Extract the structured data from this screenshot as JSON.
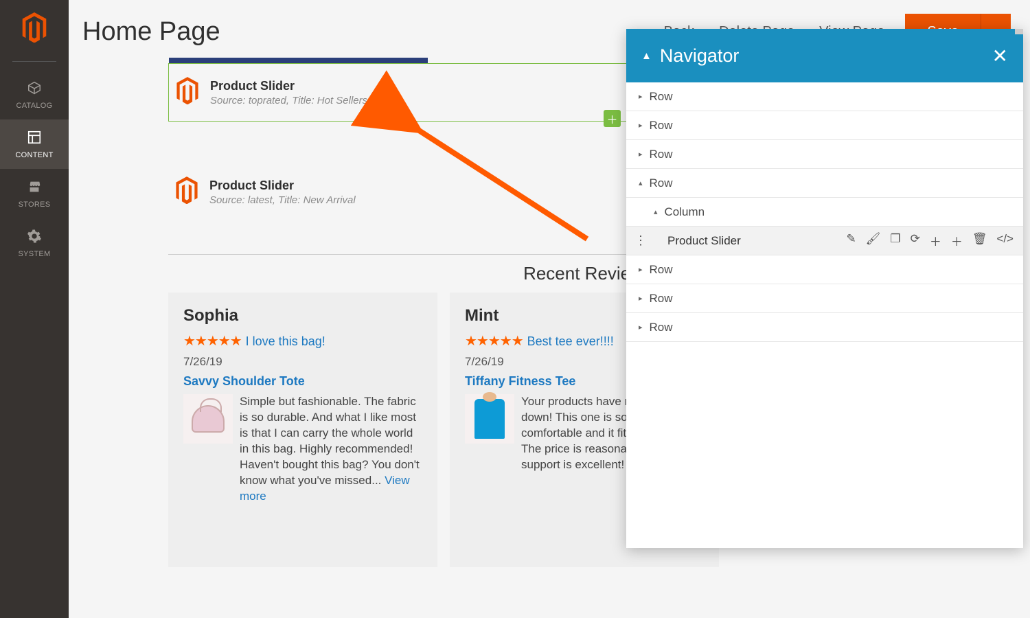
{
  "sidebar": {
    "items": [
      {
        "label": "CATALOG"
      },
      {
        "label": "CONTENT"
      },
      {
        "label": "STORES"
      },
      {
        "label": "SYSTEM"
      }
    ]
  },
  "header": {
    "title": "Home Page",
    "back": "Back",
    "delete": "Delete Page",
    "view": "View Page",
    "save": "Save"
  },
  "sliders": {
    "a": {
      "title": "Product Slider",
      "sub": "Source: toprated, Title: Hot Sellers"
    },
    "b": {
      "title": "Product Slider",
      "sub": "Source: latest, Title: New Arrival"
    }
  },
  "reviews_heading": "Recent Reviews",
  "reviews": [
    {
      "name": "Sophia",
      "title": "I love this bag!",
      "date": "7/26/19",
      "product": "Savvy Shoulder Tote",
      "body": "Simple but fashionable. The fabric is so durable. And what I like most is that I can carry the whole world in this bag. Highly recommended! Haven't bought this bag? You don't know what you've missed... ",
      "more": "View more"
    },
    {
      "name": "Mint",
      "title": "Best tee ever!!!!",
      "date": "7/26/19",
      "product": "Tiffany Fitness Tee",
      "body": "Your products have never let me down! This one is so soft and comfortable and it fits perfectly. The price is reasonable, and the support is excellent!",
      "more": ""
    }
  ],
  "navigator": {
    "title": "Navigator",
    "rows": [
      {
        "label": "Row",
        "caret": "right",
        "indent": 0
      },
      {
        "label": "Row",
        "caret": "right",
        "indent": 0
      },
      {
        "label": "Row",
        "caret": "right",
        "indent": 0
      },
      {
        "label": "Row",
        "caret": "down",
        "indent": 0
      },
      {
        "label": "Column",
        "caret": "down",
        "indent": 1
      },
      {
        "label": "Product Slider",
        "caret": "",
        "indent": 2,
        "selected": true
      },
      {
        "label": "Row",
        "caret": "right",
        "indent": 0
      },
      {
        "label": "Row",
        "caret": "right",
        "indent": 0
      },
      {
        "label": "Row",
        "caret": "right",
        "indent": 0
      }
    ]
  }
}
